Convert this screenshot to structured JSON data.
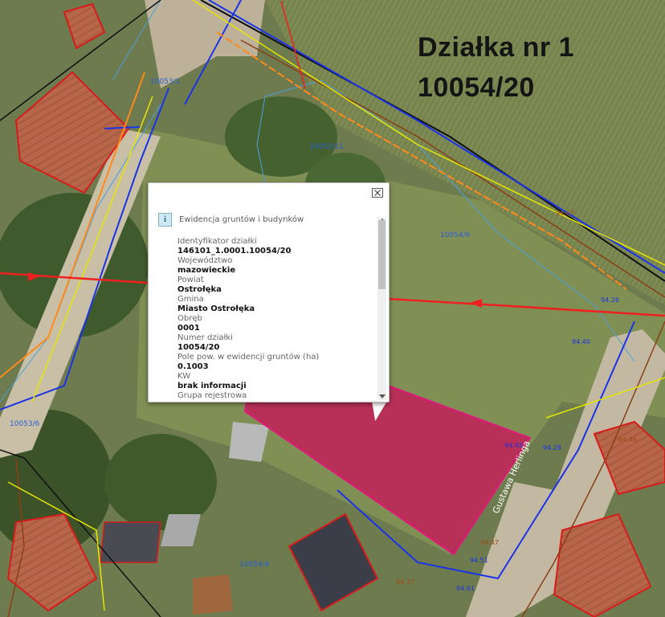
{
  "title": {
    "line1": "Działka nr 1",
    "line2": "10054/20"
  },
  "map": {
    "parcel_labels": [
      "10053/1",
      "10052/11",
      "10054/6",
      "10053/6",
      "10054/4"
    ],
    "street_label": "Gustawa Herlinga",
    "elevations": [
      "94.67",
      "94.26",
      "94.40",
      "94.43",
      "94.28",
      "94.46",
      "94.47",
      "94.51",
      "94.61",
      "94.77"
    ],
    "colors": {
      "parcel_fill": "#c8145a",
      "building_outline": "#d81b1b",
      "utility_red": "#ee2020",
      "utility_orange": "#ff8a1a",
      "utility_blue": "#1a33e6",
      "utility_yellow": "#e6e600",
      "utility_brown": "#8a3f14",
      "parcel_boundary": "#4b9fe0"
    }
  },
  "popup": {
    "title": "Ewidencja gruntów i budynków",
    "icon": "info-icon",
    "close_icon": "close-icon",
    "fields": [
      {
        "label": "Identyfikator działki",
        "value": "146101_1.0001.10054/20"
      },
      {
        "label": "Województwo",
        "value": "mazowieckie"
      },
      {
        "label": "Powiat",
        "value": "Ostrołęka"
      },
      {
        "label": "Gmina",
        "value": "Miasto Ostrołęka"
      },
      {
        "label": "Obręb",
        "value": "0001"
      },
      {
        "label": "Numer działki",
        "value": "10054/20"
      },
      {
        "label": "Pole pow. w ewidencji gruntów (ha)",
        "value": "0.1003"
      },
      {
        "label": "KW",
        "value": "brak informacji"
      },
      {
        "label": "Grupa rejestrowa",
        "value": ""
      }
    ]
  }
}
